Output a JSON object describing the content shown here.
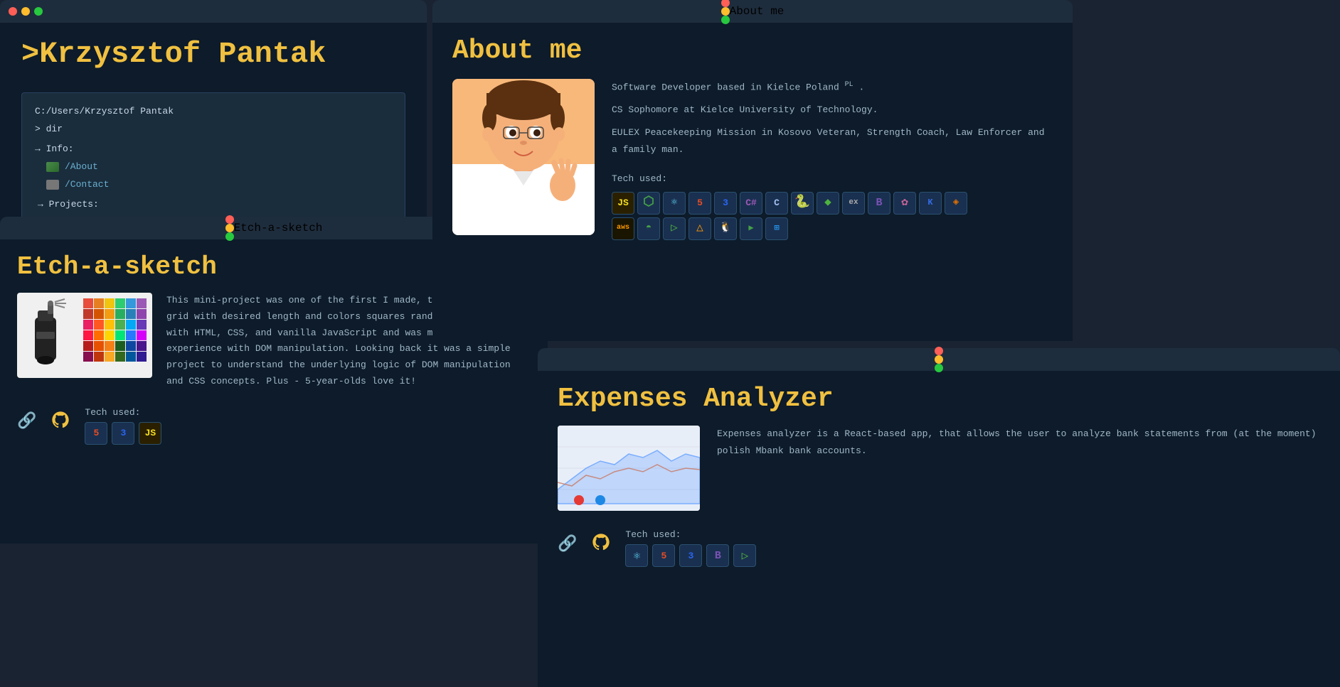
{
  "app": {
    "background": "#1a2332"
  },
  "main_terminal": {
    "title": "",
    "name_title": ">Krzysztof Pantak",
    "path": "C:/Users/Krzysztof Pantak",
    "prompt": "> dir",
    "info_label": "→ Info:",
    "about_link": "/About",
    "contact_link": "/Contact",
    "projects_label": "→ Projects:"
  },
  "etch_window": {
    "title": "Etch-a-sketch",
    "project_title": "Etch-a-sketch",
    "github_icon": "⊙",
    "description": "This mini-project was one of the first I made, that creates a grid with desired length and colors squares randomly. Written with HTML, CSS, and vanilla JavaScript and was my first experience with DOM manipulation. Looking back it was a simple project to understand the underlying logic of DOM manipulation and CSS concepts. Plus - 5-year-olds love it!",
    "tech_label": "Tech used:",
    "tech_icons": [
      {
        "label": "5",
        "name": "html5"
      },
      {
        "label": "3",
        "name": "css3"
      },
      {
        "label": "JS",
        "name": "javascript"
      }
    ],
    "link_icon": "🔗",
    "github_link_icon": "⊙"
  },
  "about_window": {
    "title": "About me",
    "section_title": "About me",
    "bio_line1": "Software Developer based in Kielce Poland",
    "bio_pl": "PL",
    "bio_period1": ".",
    "bio_line2": "CS Sophomore at Kielce University of Technology.",
    "bio_line3": "EULEX Peacekeeping Mission in Kosovo Veteran, Strength Coach, Law Enforcer and a family man.",
    "tech_label": "Tech used:",
    "tech_row1": [
      "JS",
      "⬡",
      "⚛",
      "5",
      "3",
      "C#",
      "C",
      "Py",
      "◆",
      "ex",
      "B",
      "✿",
      "K",
      "◈"
    ],
    "tech_row2": [
      "aws",
      "◓",
      "▷",
      "△",
      "🐧",
      "▶",
      "⊞"
    ]
  },
  "expenses_window": {
    "title": "",
    "project_title": "Expenses Analyzer",
    "description": "Expenses analyzer is a React-based app, that allows the user to analyze bank statements from (at the moment) polish Mbank bank accounts.",
    "tech_label": "Tech used:",
    "tech_icons": [
      "⚛",
      "5",
      "3",
      "B",
      "▷"
    ],
    "link_icon": "🔗",
    "github_link_icon": "⊙"
  },
  "color_grid": {
    "colors": [
      "#e74c3c",
      "#e67e22",
      "#f1c40f",
      "#2ecc71",
      "#3498db",
      "#9b59b6",
      "#c0392b",
      "#d35400",
      "#f39c12",
      "#27ae60",
      "#2980b9",
      "#8e44ad",
      "#e91e63",
      "#ff5722",
      "#ffc107",
      "#4caf50",
      "#03a9f4",
      "#673ab7",
      "#ff1744",
      "#ff6d00",
      "#ffd600",
      "#00e676",
      "#2979ff",
      "#d500f9",
      "#b71c1c",
      "#e65100",
      "#f57f17",
      "#1b5e20",
      "#0d47a1",
      "#4a148c",
      "#880e4f",
      "#bf360c",
      "#f9a825",
      "#33691e",
      "#01579b",
      "#311b92"
    ]
  }
}
